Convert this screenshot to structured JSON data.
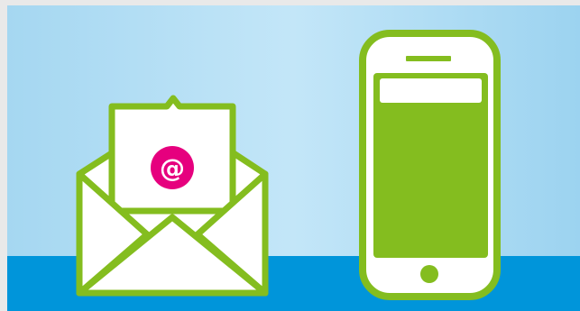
{
  "illustration": {
    "email_symbol": "@",
    "icons": [
      "open-envelope-icon",
      "at-sign-icon",
      "smartphone-icon"
    ],
    "colors": {
      "background": "#e9e9e9",
      "sky_top": "#a6d8f2",
      "sky_light": "#c3e6f8",
      "ground": "#0094d9",
      "stroke_green": "#84bd1f",
      "screen_green": "#84bd1f",
      "paper": "#ffffff",
      "at_badge": "#e6007e"
    }
  }
}
